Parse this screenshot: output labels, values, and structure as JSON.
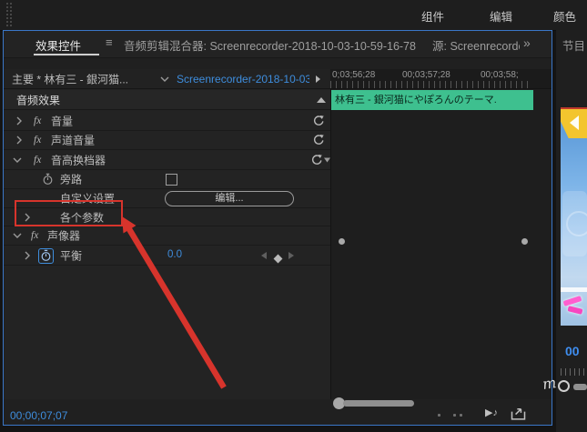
{
  "colors": {
    "accent_blue": "#3e8ddd",
    "clip_green": "#3ec08f",
    "annotation_red": "#d7342c",
    "focus_border": "#3a77c8"
  },
  "topbar": {
    "workspace_tabs": [
      "组件",
      "编辑",
      "颜色"
    ]
  },
  "left_panel": {
    "tabs": {
      "effect_controls": "效果控件",
      "audio_clip_mixer": "音频剪辑混合器: Screenrecorder-2018-10-03-10-59-16-78",
      "source": "源: Screenrecorde",
      "overflow_chevron": "»"
    },
    "header": {
      "track_label": "主要 * 林有三 - 銀河猫...",
      "clip_name": "Screenrecorder-2018-10-03..."
    },
    "ruler_ticks": [
      "0;03;56;28",
      "00;03;57;28",
      "00;03;58;"
    ],
    "sections": {
      "audio_effects": "音频效果"
    },
    "clip_bar_label": "林有三 - 銀河猫にやぽろんのテーマ.",
    "effects": [
      {
        "name": "音量"
      },
      {
        "name": "声道音量"
      },
      {
        "name": "音高换档器"
      }
    ],
    "pitch_params": {
      "bypass": "旁路",
      "custom_setup": "自定义设置",
      "edit_button": "编辑...",
      "individual_params": "各个参数"
    },
    "panner": {
      "name": "声像器",
      "balance_label": "平衡",
      "balance_value": "0.0"
    },
    "footer": {
      "timecode": "00;00;07;07"
    }
  },
  "right_panel": {
    "tab": "节目",
    "timecode": "00"
  },
  "annotation": {
    "watermark": "m"
  }
}
